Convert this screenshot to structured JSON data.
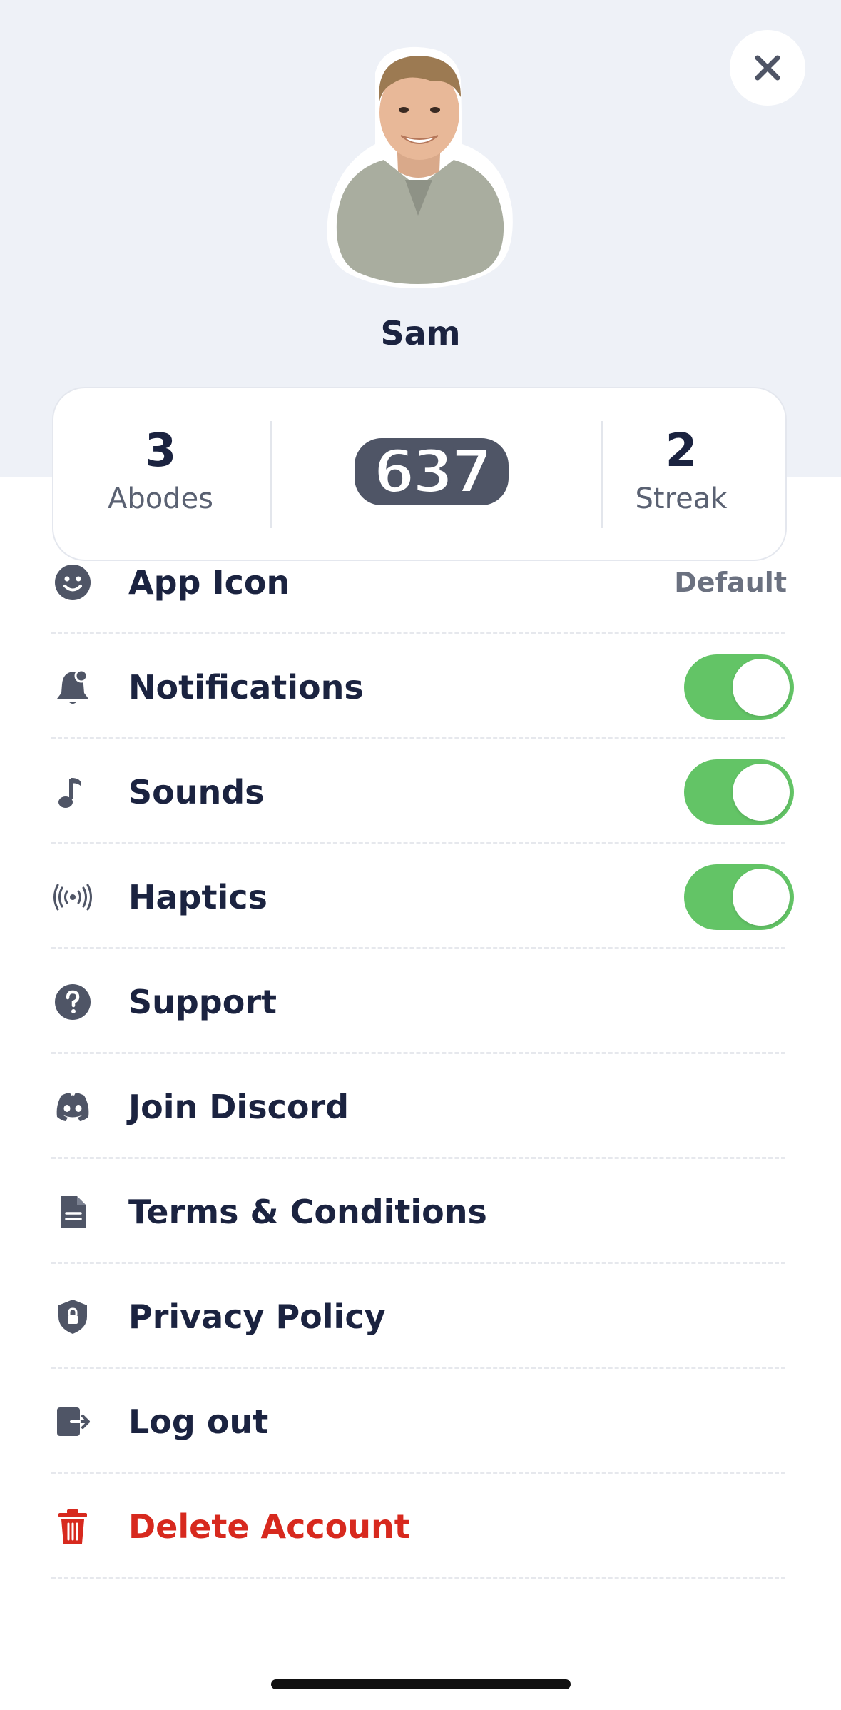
{
  "profile": {
    "name": "Sam"
  },
  "stats": {
    "abodes": {
      "value": "3",
      "label": "Abodes"
    },
    "score": "637",
    "streak": {
      "value": "2",
      "label": "Streak"
    }
  },
  "menu": {
    "items": [
      {
        "label": "App Icon",
        "icon": "smiley-icon",
        "value": "Default"
      },
      {
        "label": "Notifications",
        "icon": "bell-icon",
        "toggle": true
      },
      {
        "label": "Sounds",
        "icon": "music-note-icon",
        "toggle": true
      },
      {
        "label": "Haptics",
        "icon": "vibration-icon",
        "toggle": true
      },
      {
        "label": "Support",
        "icon": "question-icon"
      },
      {
        "label": "Join Discord",
        "icon": "discord-icon"
      },
      {
        "label": "Terms & Conditions",
        "icon": "document-icon"
      },
      {
        "label": "Privacy Policy",
        "icon": "shield-icon"
      },
      {
        "label": "Log out",
        "icon": "logout-icon"
      },
      {
        "label": "Delete Account",
        "icon": "trash-icon",
        "danger": true
      }
    ]
  },
  "colors": {
    "text_primary": "#1b2340",
    "icon_gray": "#4f5566",
    "toggle_on": "#63c466",
    "danger": "#d7291e",
    "header_bg": "#eef1f7"
  }
}
